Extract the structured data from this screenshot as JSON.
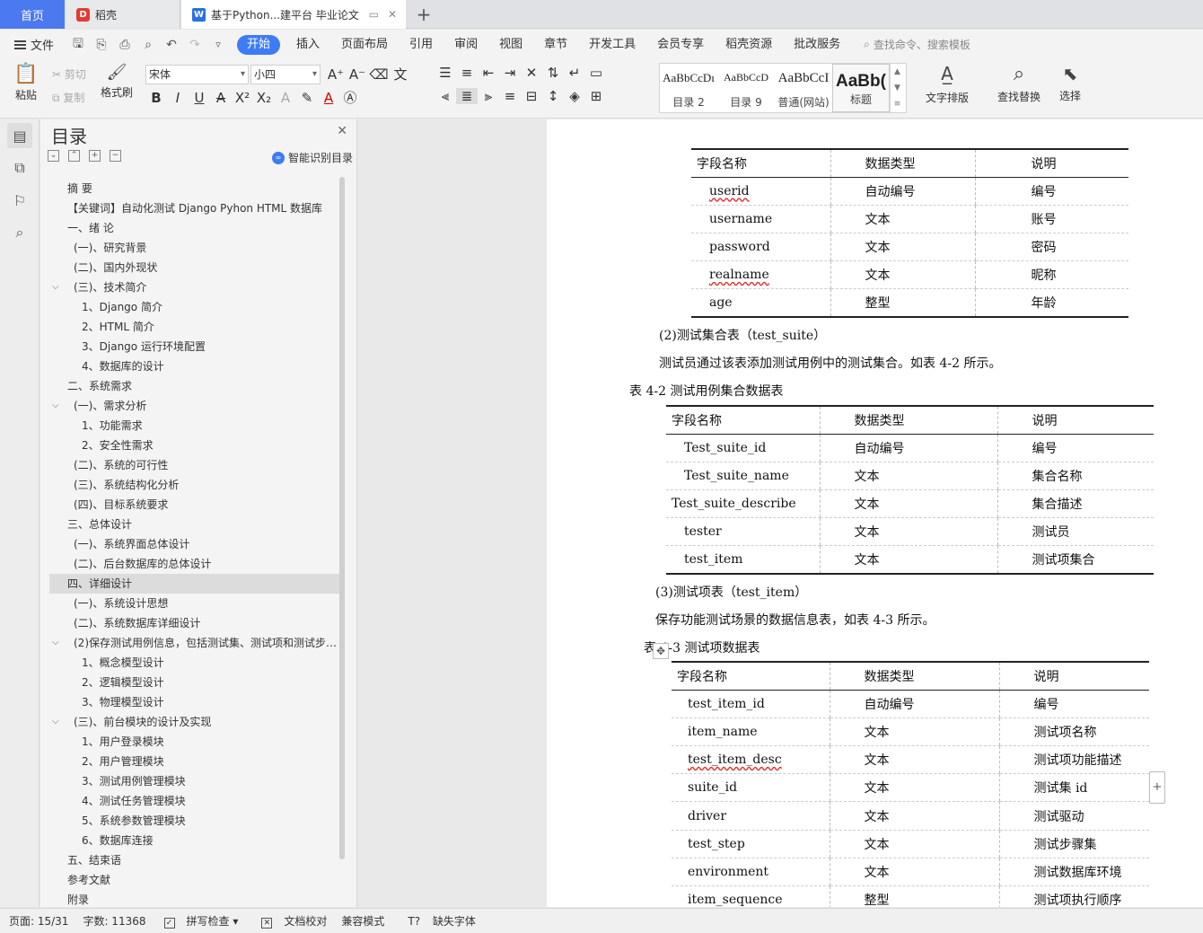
{
  "tabs": {
    "home": "首页",
    "daoke": "稻壳",
    "doc": "基于Python...建平台 毕业论文"
  },
  "menu": {
    "file": "文件",
    "items": [
      "开始",
      "插入",
      "页面布局",
      "引用",
      "审阅",
      "视图",
      "章节",
      "开发工具",
      "会员专享",
      "稻壳资源",
      "批改服务"
    ],
    "search_placeholder": "查找命令、搜索模板"
  },
  "ribbon": {
    "paste": "粘贴",
    "cut": "剪切",
    "copy": "复制",
    "format_painter": "格式刷",
    "font_name": "宋体",
    "font_size": "小四",
    "styles": [
      {
        "preview": "AaBbCcDı",
        "name": "目录 2"
      },
      {
        "preview": "AaBbCcD",
        "name": "目录 9"
      },
      {
        "preview": "AaBbCcI",
        "name": "普通(网站)"
      },
      {
        "preview": "AaBb(",
        "name": "标题"
      }
    ],
    "text_layout": "文字排版",
    "find_replace": "查找替换",
    "select": "选择"
  },
  "toc": {
    "title": "目录",
    "smart": "智能识别目录",
    "items": [
      {
        "text": "摘  要",
        "indent": 1,
        "chev": false
      },
      {
        "text": "【关键词】自动化测试  Django Pyhon HTML 数据库",
        "indent": 1,
        "chev": false
      },
      {
        "text": "一、绪  论",
        "indent": 1,
        "chev": false
      },
      {
        "text": "(一)、研究背景",
        "indent": 2,
        "chev": false
      },
      {
        "text": "(二)、国内外现状",
        "indent": 2,
        "chev": false
      },
      {
        "text": "(三)、技术简介",
        "indent": 2,
        "chev": true
      },
      {
        "text": "1、Django 简介",
        "indent": 3,
        "chev": false
      },
      {
        "text": "2、HTML 简介",
        "indent": 3,
        "chev": false
      },
      {
        "text": "3、Django 运行环境配置",
        "indent": 3,
        "chev": false
      },
      {
        "text": "4、数据库的设计",
        "indent": 3,
        "chev": false
      },
      {
        "text": "二、系统需求",
        "indent": 1,
        "chev": false
      },
      {
        "text": "(一)、需求分析",
        "indent": 2,
        "chev": true
      },
      {
        "text": "1、功能需求",
        "indent": 3,
        "chev": false
      },
      {
        "text": "2、安全性需求",
        "indent": 3,
        "chev": false
      },
      {
        "text": "(二)、系统的可行性",
        "indent": 2,
        "chev": false
      },
      {
        "text": "(三)、系统结构化分析",
        "indent": 2,
        "chev": false
      },
      {
        "text": "(四)、目标系统要求",
        "indent": 2,
        "chev": false
      },
      {
        "text": "三、总体设计",
        "indent": 1,
        "chev": false
      },
      {
        "text": "(一)、系统界面总体设计",
        "indent": 2,
        "chev": false
      },
      {
        "text": "(二)、后台数据库的总体设计",
        "indent": 2,
        "chev": false
      },
      {
        "text": "四、详细设计",
        "indent": 1,
        "chev": false,
        "selected": true
      },
      {
        "text": "(一)、系统设计思想",
        "indent": 2,
        "chev": false
      },
      {
        "text": "(二)、系统数据库详细设计",
        "indent": 2,
        "chev": false
      },
      {
        "text": "(2)保存测试用例信息，包括测试集、测试项和测试步骤...",
        "indent": 2,
        "chev": true
      },
      {
        "text": "1、概念模型设计",
        "indent": 3,
        "chev": false
      },
      {
        "text": "2、逻辑模型设计",
        "indent": 3,
        "chev": false
      },
      {
        "text": "3、物理模型设计",
        "indent": 3,
        "chev": false
      },
      {
        "text": "(三)、前台模块的设计及实现",
        "indent": 2,
        "chev": true
      },
      {
        "text": "1、用户登录模块",
        "indent": 3,
        "chev": false
      },
      {
        "text": "2、用户管理模块",
        "indent": 3,
        "chev": false
      },
      {
        "text": "3、测试用例管理模块",
        "indent": 3,
        "chev": false
      },
      {
        "text": "4、测试任务管理模块",
        "indent": 3,
        "chev": false
      },
      {
        "text": "5、系统参数管理模块",
        "indent": 3,
        "chev": false
      },
      {
        "text": "6、数据库连接",
        "indent": 3,
        "chev": false
      },
      {
        "text": "五、结束语",
        "indent": 1,
        "chev": false
      },
      {
        "text": "参考文献",
        "indent": 1,
        "chev": false
      },
      {
        "text": "附录",
        "indent": 1,
        "chev": false
      }
    ]
  },
  "document": {
    "headers": [
      "字段名称",
      "数据类型",
      "说明"
    ],
    "table1": [
      [
        "userid",
        "自动编号",
        "编号"
      ],
      [
        "username",
        "文本",
        "账号"
      ],
      [
        "password",
        "文本",
        "密码"
      ],
      [
        "realname",
        "文本",
        "昵称"
      ],
      [
        "age",
        "整型",
        "年龄"
      ]
    ],
    "p1": "(2)测试集合表（test_suite）",
    "p2": "测试员通过该表添加测试用例中的测试集合。如表 4-2 所示。",
    "caption2": "表 4-2 测试用例集合数据表",
    "table2": [
      [
        "Test_suite_id",
        "自动编号",
        "编号"
      ],
      [
        "Test_suite_name",
        "文本",
        "集合名称"
      ],
      [
        "Test_suite_describe",
        "文本",
        "集合描述"
      ],
      [
        "tester",
        "文本",
        "测试员"
      ],
      [
        "test_item",
        "文本",
        "测试项集合"
      ]
    ],
    "p3": "(3)测试项表（test_item）",
    "p4": "保存功能测试场景的数据信息表，如表 4-3 所示。",
    "caption3": "表 4-3 测试项数据表",
    "table3": [
      [
        "test_item_id",
        "自动编号",
        "编号"
      ],
      [
        "item_name",
        "文本",
        "测试项名称"
      ],
      [
        "test_item_desc",
        "文本",
        "测试项功能描述"
      ],
      [
        "suite_id",
        "文本",
        "测试集 id"
      ],
      [
        "driver",
        "文本",
        "测试驱动"
      ],
      [
        "test_step",
        "文本",
        "测试步骤集"
      ],
      [
        "environment",
        "文本",
        "测试数据库环境"
      ],
      [
        "item_sequence",
        "整型",
        "测试项执行顺序"
      ]
    ]
  },
  "status": {
    "page": "页面: 15/31",
    "words": "字数: 11368",
    "spell": "拼写检查",
    "proof": "文档校对",
    "compat": "兼容模式",
    "missing_font": "缺失字体"
  },
  "colors": {
    "accent": "#3d7cf5",
    "home_tab": "#4a79f0"
  }
}
